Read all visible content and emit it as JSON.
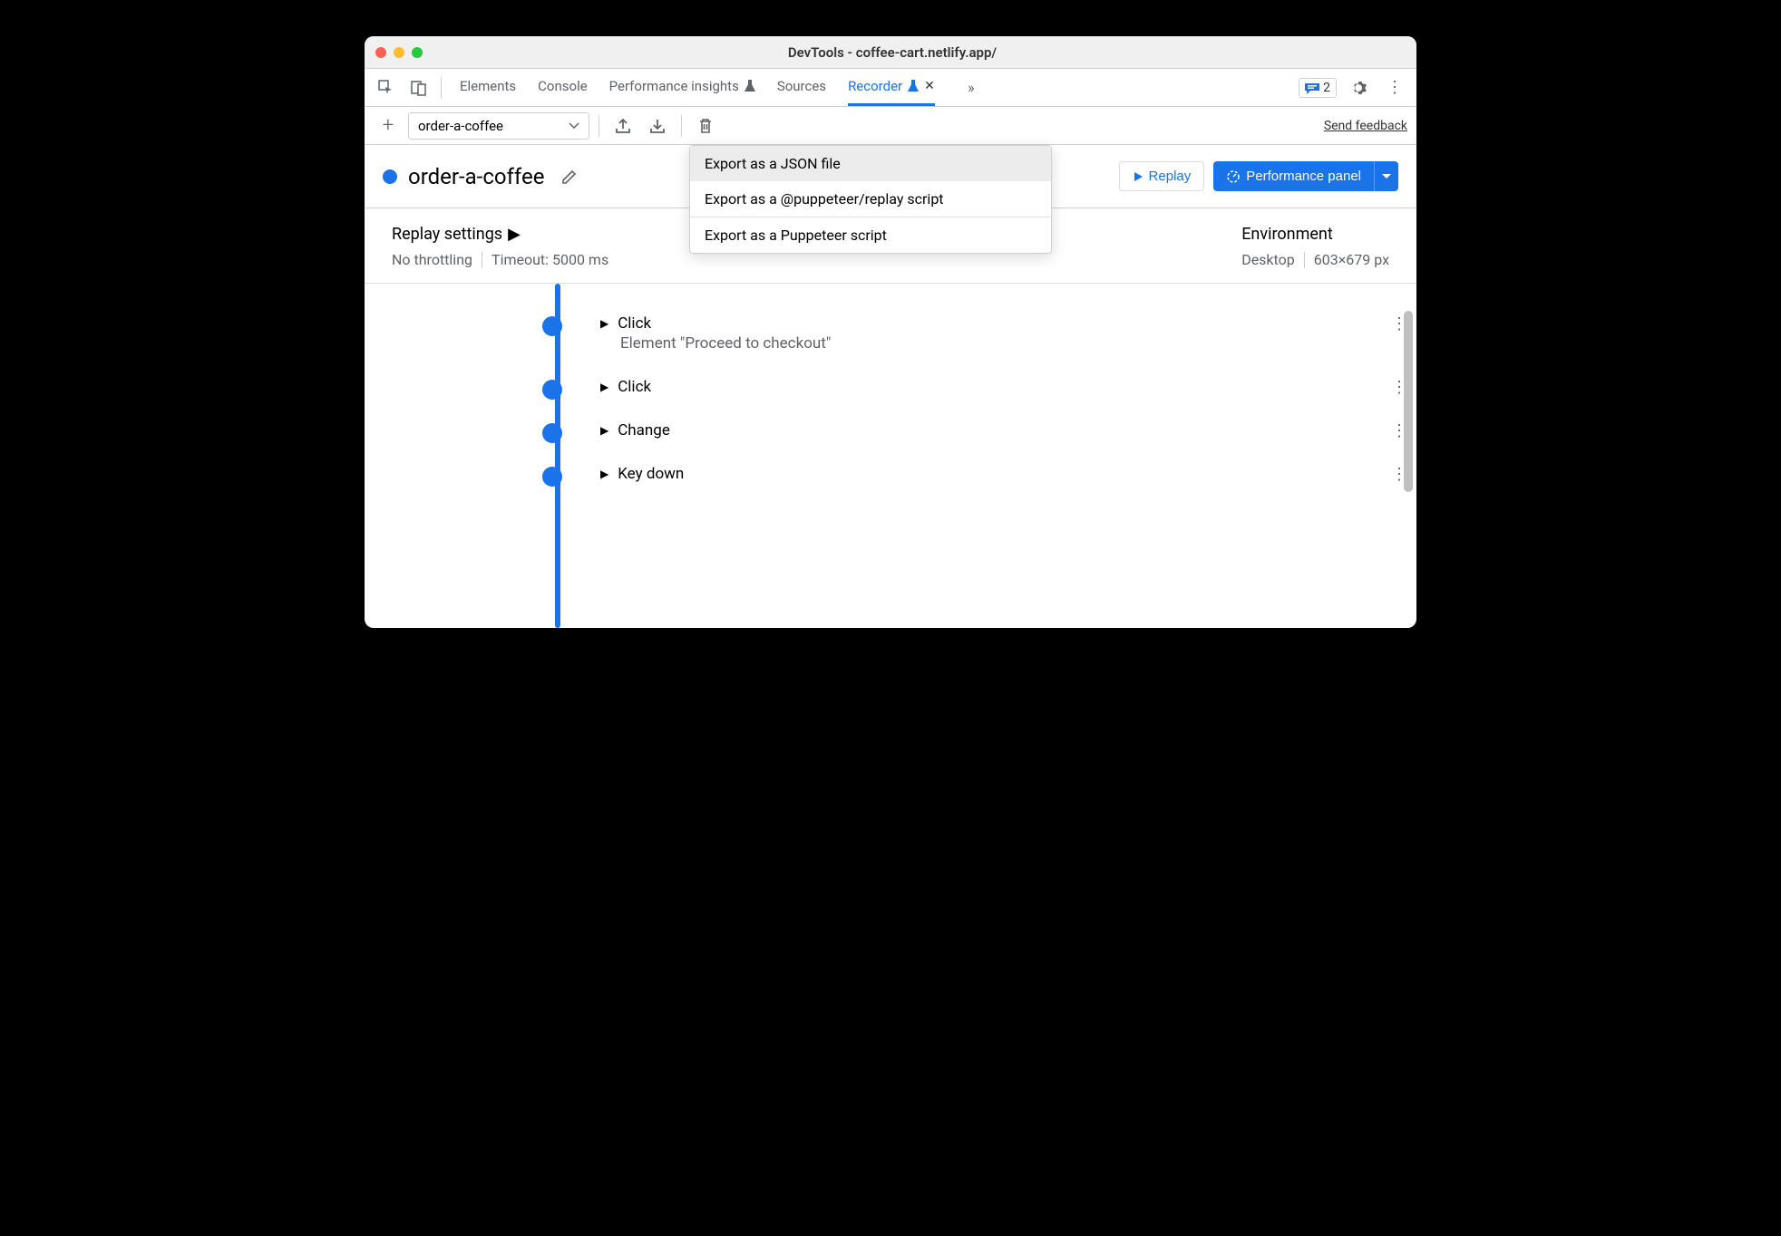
{
  "window": {
    "title": "DevTools - coffee-cart.netlify.app/"
  },
  "tabs": {
    "elements": "Elements",
    "console": "Console",
    "perf_insights": "Performance insights",
    "sources": "Sources",
    "recorder": "Recorder"
  },
  "issues": {
    "count": "2"
  },
  "recorder_toolbar": {
    "recording_name": "order-a-coffee",
    "feedback": "Send feedback"
  },
  "recording": {
    "title": "order-a-coffee",
    "replay_label": "Replay",
    "perf_panel_label": "Performance panel"
  },
  "export_menu": {
    "json": "Export as a JSON file",
    "puppeteer_replay": "Export as a @puppeteer/replay script",
    "puppeteer": "Export as a Puppeteer script"
  },
  "settings": {
    "replay_title": "Replay settings",
    "throttling": "No throttling",
    "timeout": "Timeout: 5000 ms",
    "env_title": "Environment",
    "device": "Desktop",
    "viewport": "603×679 px"
  },
  "steps": [
    {
      "title": "Click",
      "subtitle": "Element \"Proceed to checkout\""
    },
    {
      "title": "Click",
      "subtitle": ""
    },
    {
      "title": "Change",
      "subtitle": ""
    },
    {
      "title": "Key down",
      "subtitle": ""
    }
  ]
}
